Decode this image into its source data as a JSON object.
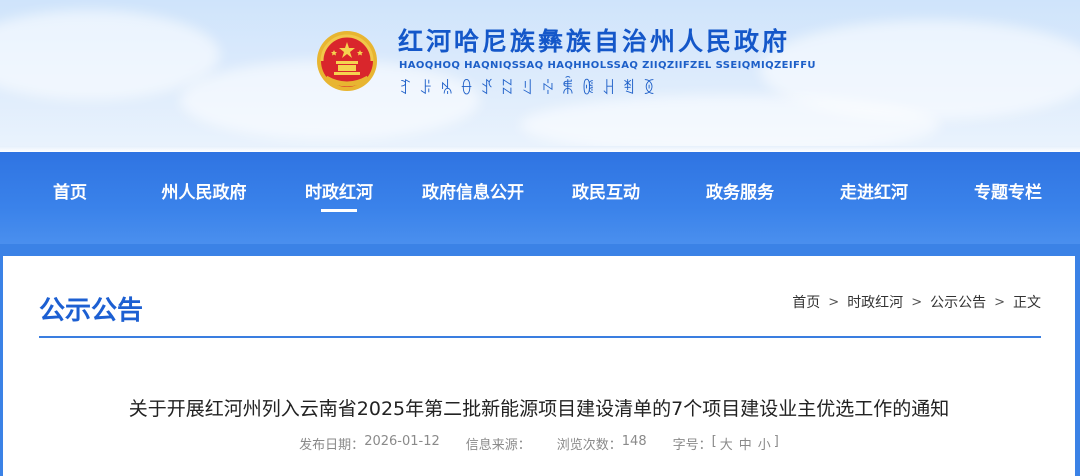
{
  "header": {
    "title": "红河哈尼族彝族自治州人民政府",
    "subtitle_pinyin": "HAOQHOQ HAQNIQSSAQ HAQHHOLSSAQ ZIIQZIIFZEL SSEIQMIQZEIFFU",
    "subtitle_yi": "ꆈꌠꁱꂷꀋꉆꆹꏢꐨꍆꃅꄮꅉ",
    "emblem": "national-emblem"
  },
  "nav": {
    "items": [
      {
        "label": "首页"
      },
      {
        "label": "州人民政府"
      },
      {
        "label": "时政红河",
        "active": true
      },
      {
        "label": "政府信息公开"
      },
      {
        "label": "政民互动"
      },
      {
        "label": "政务服务"
      },
      {
        "label": "走进红河"
      },
      {
        "label": "专题专栏"
      }
    ]
  },
  "section": {
    "title": "公示公告"
  },
  "breadcrumb": {
    "items": [
      "首页",
      "时政红河",
      "公示公告",
      "正文"
    ],
    "separator": ">"
  },
  "article": {
    "title": "关于开展红河州列入云南省2025年第二批新能源项目建设清单的7个项目建设业主优选工作的通知",
    "meta": {
      "date_label": "发布日期：",
      "date": "2026-01-12",
      "source_label": "信息来源：",
      "views_label": "浏览次数：",
      "views": "148",
      "fontsize_label": "字号：",
      "fontsize_open": "[",
      "fontsize_large": "大",
      "fontsize_medium": "中",
      "fontsize_small": "小",
      "fontsize_close": "]"
    }
  },
  "colors": {
    "nav_bg": "#3a82ea",
    "title_blue": "#1c5fd2",
    "header_title": "#1457c9"
  }
}
